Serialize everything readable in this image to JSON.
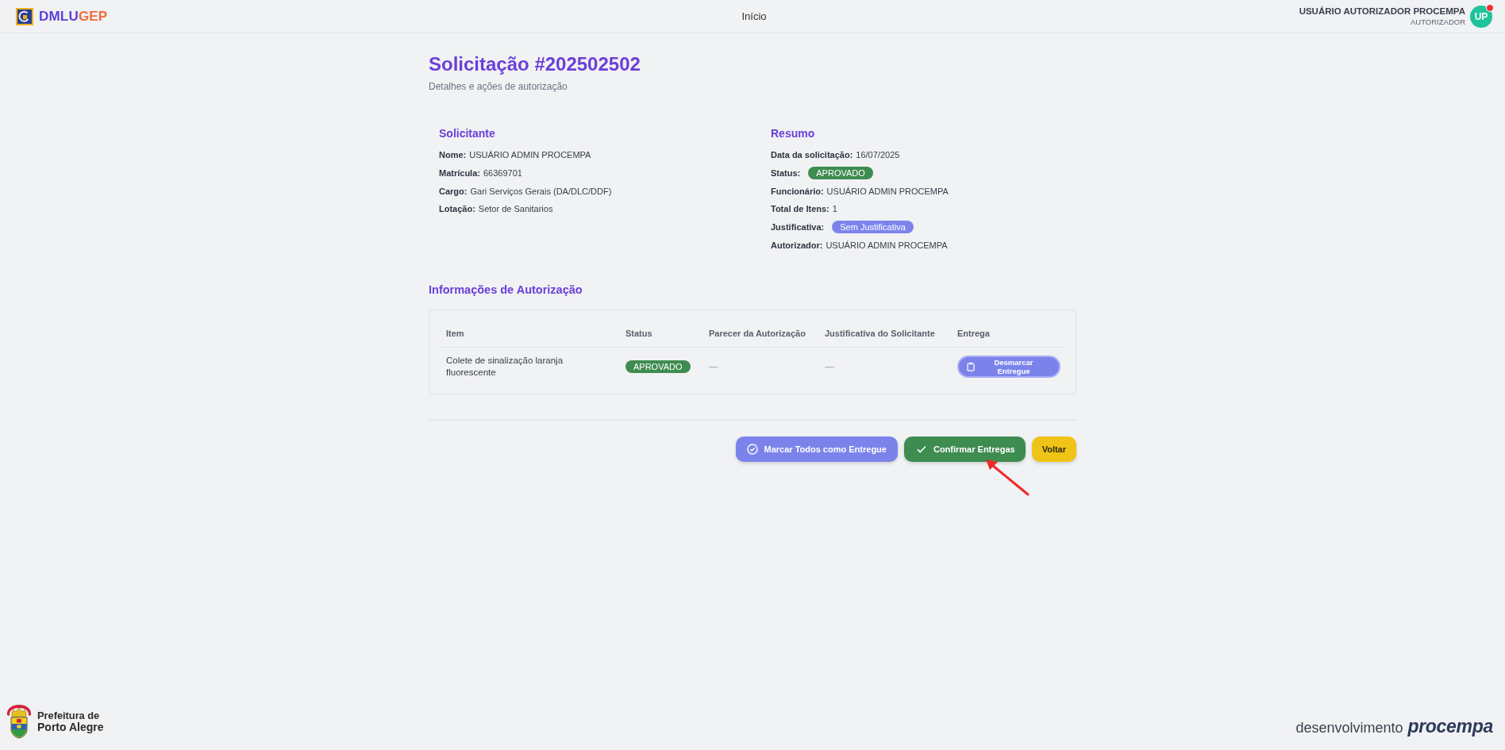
{
  "header": {
    "brand": {
      "primary": "DMLU",
      "accent": "GEP"
    },
    "nav": [
      {
        "label": "Início"
      }
    ],
    "user": {
      "name": "USUÁRIO AUTORIZADOR PROCEMPA",
      "role": "AUTORIZADOR",
      "initials": "UP",
      "notification": true
    }
  },
  "page": {
    "title": "Solicitação #202502502",
    "subtitle": "Detalhes e ações de autorização"
  },
  "solicitante": {
    "heading": "Solicitante",
    "fields": [
      {
        "label": "Nome:",
        "value": "USUÁRIO ADMIN PROCEMPA",
        "kind": "text"
      },
      {
        "label": "Matrícula:",
        "value": "66369701",
        "kind": "text"
      },
      {
        "label": "Cargo:",
        "value": "Gari Serviços Gerais (DA/DLC/DDF)",
        "kind": "text"
      },
      {
        "label": "Lotação:",
        "value": "Setor de Sanitarios",
        "kind": "text"
      }
    ]
  },
  "resumo": {
    "heading": "Resumo",
    "fields": [
      {
        "label": "Data da solicitação:",
        "value": "16/07/2025",
        "kind": "text"
      },
      {
        "label": "Status:",
        "value": "APROVADO",
        "kind": "badge",
        "color": "#3e8c50"
      },
      {
        "label": "Funcionário:",
        "value": "USUÁRIO ADMIN PROCEMPA",
        "kind": "text"
      },
      {
        "label": "Total de Itens:",
        "value": "1",
        "kind": "text"
      },
      {
        "label": "Justificativa:",
        "value": "Sem Justificativa",
        "kind": "badge",
        "color": "#7c84ec"
      },
      {
        "label": "Autorizador:",
        "value": "USUÁRIO ADMIN PROCEMPA",
        "kind": "text"
      }
    ]
  },
  "autorizacao": {
    "heading": "Informações de Autorização",
    "table": {
      "columns": [
        "Item",
        "Status",
        "Parecer da Autorização",
        "Justificativa do Solicitante",
        "Entrega"
      ],
      "rows": [
        {
          "cells": [
            {
              "kind": "text",
              "text": "Colete de sinalização laranja fluorescente"
            },
            {
              "kind": "badge",
              "text": "APROVADO",
              "color": "#3e8c50"
            },
            {
              "kind": "empty",
              "text": "—"
            },
            {
              "kind": "empty",
              "text": "—"
            },
            {
              "kind": "button",
              "text": "Desmarcar Entregue"
            }
          ]
        }
      ]
    }
  },
  "actions": [
    {
      "label": "Marcar Todos como Entregue",
      "kind": "secondary"
    },
    {
      "label": "Confirmar Entregas",
      "kind": "primary"
    },
    {
      "label": "Voltar",
      "kind": "warning"
    }
  ],
  "footer": {
    "left": [
      "Prefeitura de",
      "Porto Alegre"
    ],
    "right": {
      "prefix": "desenvolvimento",
      "brand": "procempa"
    }
  }
}
